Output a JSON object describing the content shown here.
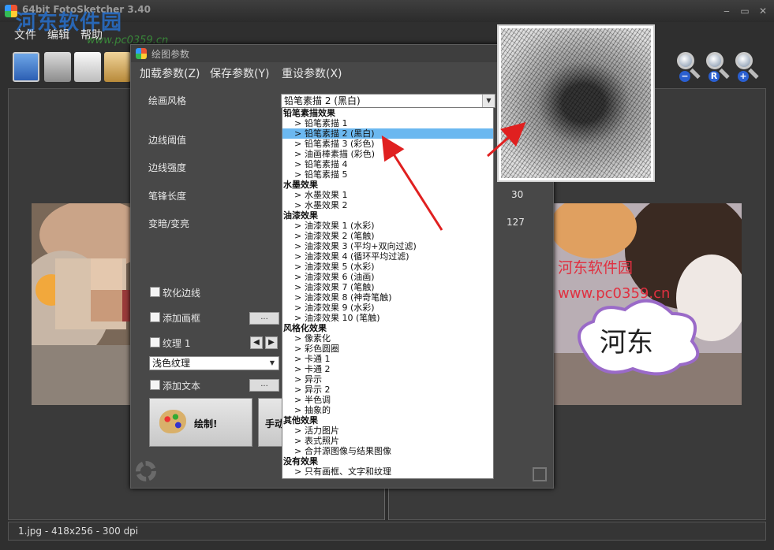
{
  "app": {
    "title": "64bit FotoSketcher 3.40",
    "watermark": "河东软件园",
    "watermark_url": "www.pc0359.cn"
  },
  "window_controls": {
    "minimize": "‒",
    "maximize": "▭",
    "close": "✕"
  },
  "menubar": {
    "file": "文件",
    "edit": "编辑",
    "help": "帮助"
  },
  "toolbar": {
    "icons": [
      "open-image-icon",
      "save-icon",
      "copy-icon",
      "paste-icon"
    ],
    "zoom_icons": [
      "zoom-out-icon",
      "zoom-fit-icon",
      "zoom-in-icon"
    ],
    "zoom_badges": [
      "−",
      "R",
      "+"
    ]
  },
  "dialog": {
    "title": "绘图参数",
    "menu": {
      "load": "加载参数(Z)",
      "save": "保存参数(Y)",
      "reset": "重设参数(X)"
    },
    "style_label": "绘画风格",
    "style_value": "铅笔素描 2 (黑白)",
    "params": [
      {
        "label": "边线阈值",
        "value": ""
      },
      {
        "label": "边线强度",
        "value": ""
      },
      {
        "label": "笔锋长度",
        "value": "30"
      },
      {
        "label": "变暗/变亮",
        "value": "127"
      }
    ],
    "checks": {
      "soften_edges": "软化边线",
      "add_frame": "添加画框",
      "texture": "纹理 1",
      "add_text": "添加文本"
    },
    "ellipsis": "...",
    "texture_value": "浅色纹理",
    "draw_button": "绘制!",
    "manual_button": "手动"
  },
  "style_list": [
    {
      "group": "铅笔素描效果",
      "items": [
        "铅笔素描 1",
        "铅笔素描 2 (黑白)",
        "铅笔素描 3 (彩色)",
        "油画棒素描 (彩色)",
        "铅笔素描 4",
        "铅笔素描 5"
      ]
    },
    {
      "group": "水墨效果",
      "items": [
        "水墨效果 1",
        "水墨效果 2"
      ]
    },
    {
      "group": "油漆效果",
      "items": [
        "油漆效果 1 (水彩)",
        "油漆效果 2 (笔触)",
        "油漆效果 3 (平均+双向过滤)",
        "油漆效果 4 (循环平均过滤)",
        "油漆效果 5 (水彩)",
        "油漆效果 6 (油画)",
        "油漆效果 7 (笔触)",
        "油漆效果 8 (神奇笔触)",
        "油漆效果 9 (水彩)",
        "油漆效果 10 (笔触)"
      ]
    },
    {
      "group": "风格化效果",
      "items": [
        "像素化",
        "彩色圆圈",
        "卡通 1",
        "卡通 2",
        "异示",
        "异示 2",
        "半色调",
        "抽象的"
      ]
    },
    {
      "group": "其他效果",
      "items": [
        "活力图片",
        "表式照片",
        "合并源图像与结果图像"
      ]
    },
    {
      "group": "没有效果",
      "items": [
        "只有画框、文字和纹理"
      ]
    }
  ],
  "selected_style": "铅笔素描 2 (黑白)",
  "right_image": {
    "watermark_name": "河东软件园",
    "watermark_url": "www.pc0359.cn",
    "bubble_text": "河东"
  },
  "status": {
    "text": "1.jpg - 418x256 - 300 dpi"
  },
  "colors": {
    "accent_selection": "#6bb8f0",
    "arrow": "#e02020"
  }
}
